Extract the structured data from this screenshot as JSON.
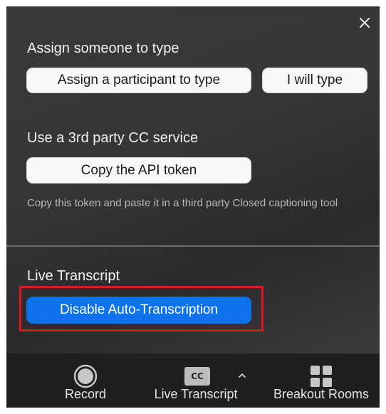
{
  "panel": {
    "close_glyph": "✕",
    "assign_section": {
      "title": "Assign someone to type",
      "assign_participant_button": "Assign a participant to type",
      "i_will_type_button": "I will type"
    },
    "third_party_section": {
      "title": "Use a 3rd party CC service",
      "copy_api_token_button": "Copy the API token",
      "hint": "Copy this token and paste it in a third party Closed captioning tool"
    },
    "live_transcript_section": {
      "title": "Live Transcript",
      "disable_auto_transcription_button": "Disable Auto-Transcription"
    }
  },
  "toolbar": {
    "record": {
      "label": "Record",
      "icon": "record-icon"
    },
    "live_transcript": {
      "label": "Live Transcript",
      "icon_text": "CC",
      "caret": "^"
    },
    "breakout_rooms": {
      "label": "Breakout Rooms",
      "icon": "grid-icon"
    }
  },
  "colors": {
    "accent_blue": "#0E72ED",
    "highlight_red": "#E0161E",
    "panel_bg": "#38383A",
    "toolbar_bg": "#1F1F21"
  }
}
